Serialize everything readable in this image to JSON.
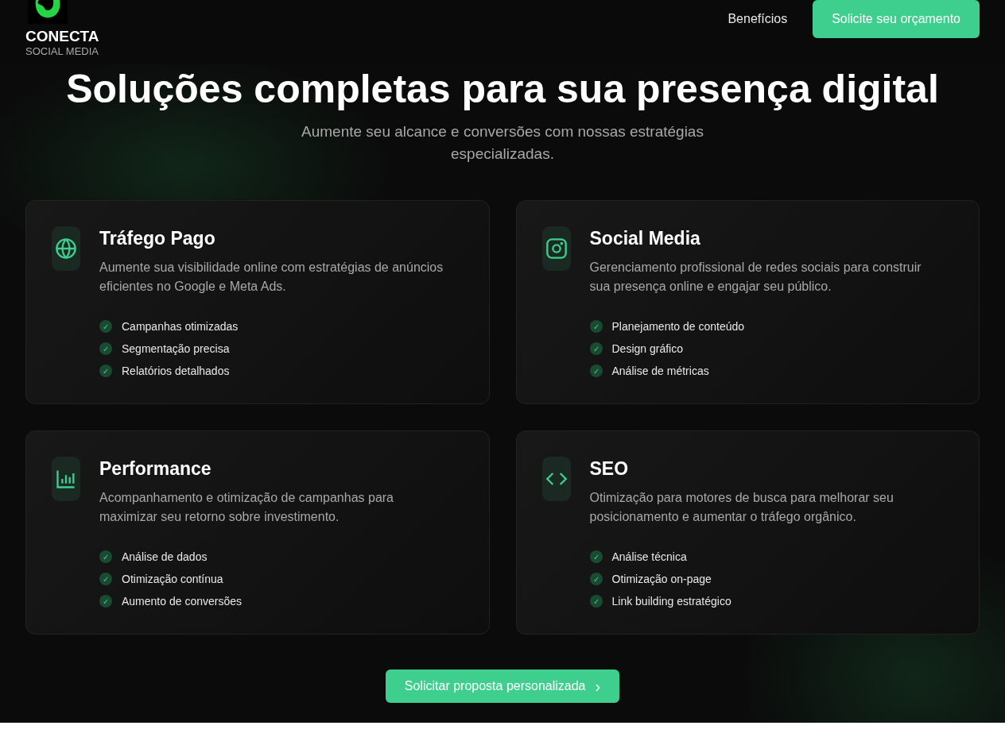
{
  "header": {
    "brand": "CONECTA",
    "tagline": "SOCIAL MEDIA",
    "nav": [
      {
        "label": "Benefícios"
      }
    ],
    "cta": "Solicite seu orçamento"
  },
  "hero": {
    "title": "Soluções completas para sua presença digital",
    "subtitle": "Aumente seu alcance e conversões com nossas estratégias especializadas."
  },
  "services": [
    {
      "kind": "globe",
      "title": "Tráfego Pago",
      "description": "Aumente sua visibilidade online com estratégias de anúncios eficientes no Google e Meta Ads.",
      "features": [
        "Campanhas otimizadas",
        "Segmentação precisa",
        "Relatórios detalhados"
      ]
    },
    {
      "kind": "instagram",
      "title": "Social Media",
      "description": "Gerenciamento profissional de redes sociais para construir sua presença online e engajar seu público.",
      "features": [
        "Planejamento de conteúdo",
        "Design gráfico",
        "Análise de métricas"
      ]
    },
    {
      "kind": "chart",
      "title": "Performance",
      "description": "Acompanhamento e otimização de campanhas para maximizar seu retorno sobre investimento.",
      "features": [
        "Análise de dados",
        "Otimização contínua",
        "Aumento de conversões"
      ]
    },
    {
      "kind": "code",
      "title": "SEO",
      "description": "Otimização para motores de busca para melhorar seu posicionamento e aumentar o tráfego orgânico.",
      "features": [
        "Análise técnica",
        "Otimização on-page",
        "Link building estratégico"
      ]
    }
  ],
  "proposal_button": "Solicitar proposta personalizada",
  "check_mark": "✓",
  "chevron": "›"
}
